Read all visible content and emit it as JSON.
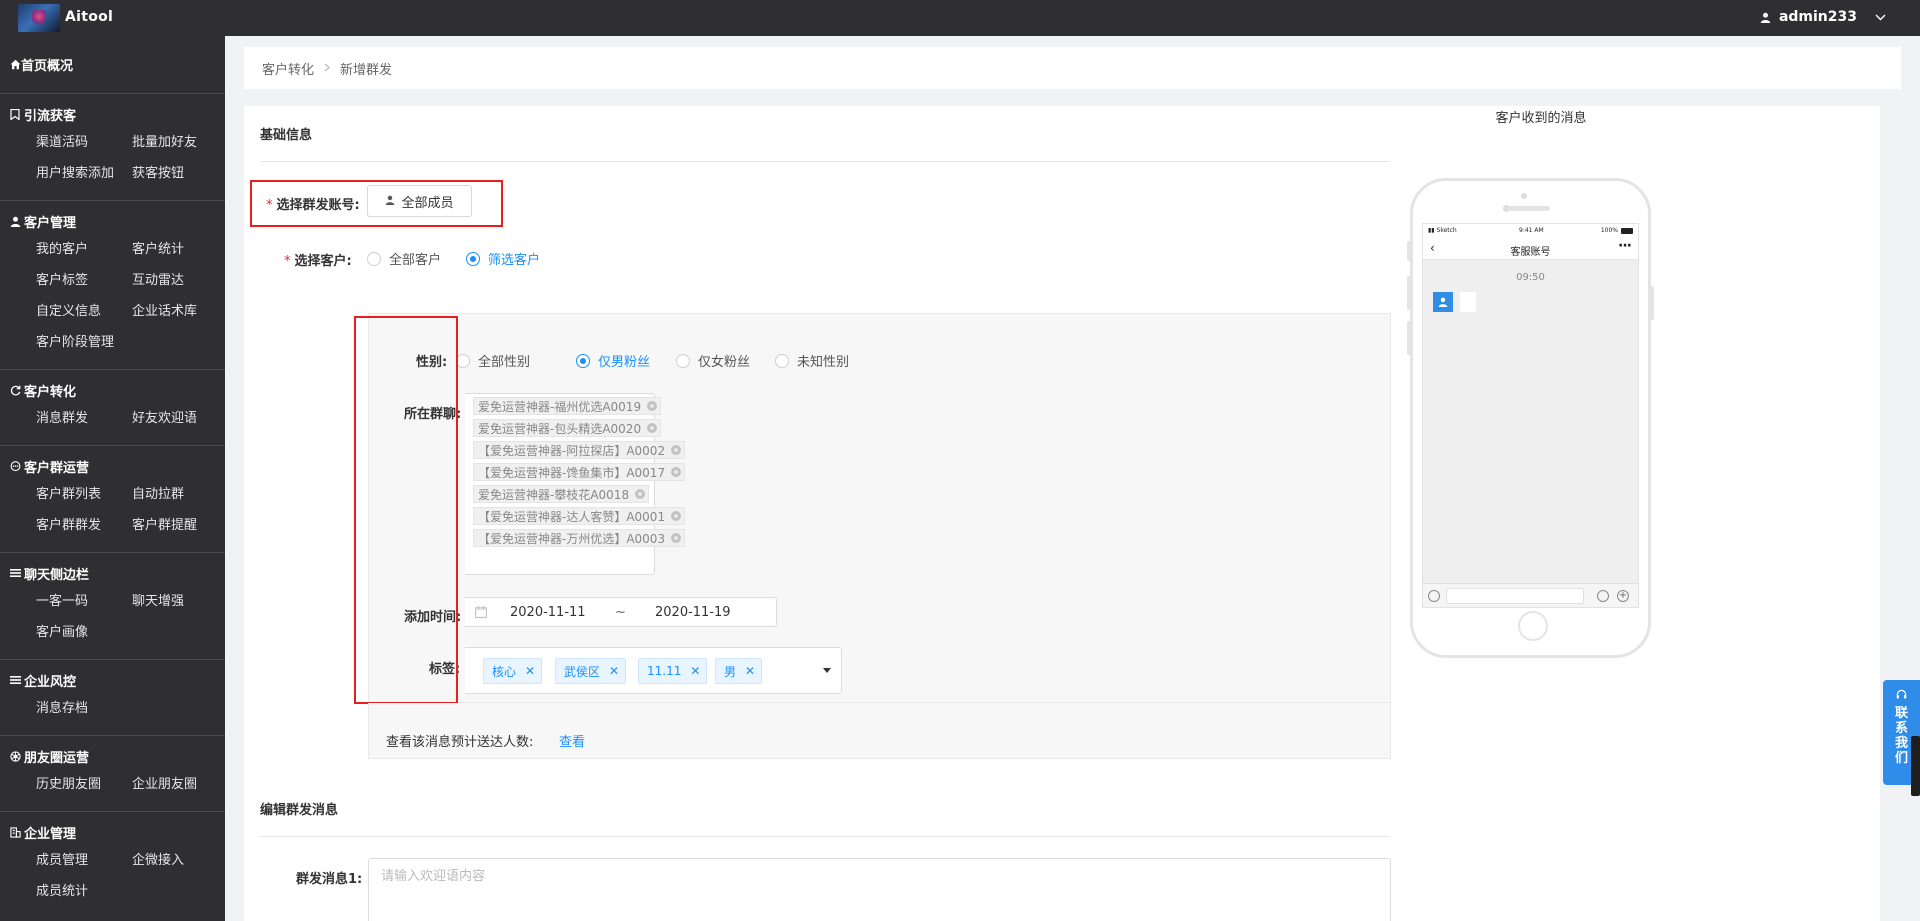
{
  "app": {
    "title": "Aitool",
    "user": "admin233"
  },
  "sidebar": {
    "home": "首页概况",
    "groups": [
      {
        "title": "引流获客",
        "icon": "bookmark-icon",
        "items": [
          "渠道活码",
          "批量加好友",
          "用户搜索添加",
          "获客按钮"
        ]
      },
      {
        "title": "客户管理",
        "icon": "user-icon",
        "items": [
          "我的客户",
          "客户统计",
          "客户标签",
          "互动雷达",
          "自定义信息",
          "企业话术库",
          "客户阶段管理"
        ]
      },
      {
        "title": "客户转化",
        "icon": "refresh-icon",
        "items": [
          "消息群发",
          "好友欢迎语"
        ]
      },
      {
        "title": "客户群运营",
        "icon": "chat-icon",
        "items": [
          "客户群列表",
          "自动拉群",
          "客户群群发",
          "客户群提醒"
        ]
      },
      {
        "title": "聊天侧边栏",
        "icon": "menu-icon",
        "items": [
          "一客一码",
          "聊天增强",
          "客户画像"
        ]
      },
      {
        "title": "企业风控",
        "icon": "menu-icon",
        "items": [
          "消息存档"
        ]
      },
      {
        "title": "朋友圈运营",
        "icon": "aperture-icon",
        "items": [
          "历史朋友圈",
          "企业朋友圈"
        ]
      },
      {
        "title": "企业管理",
        "icon": "building-icon",
        "items": [
          "成员管理",
          "企微接入",
          "成员统计"
        ]
      }
    ]
  },
  "breadcrumb": {
    "parent": "客户转化",
    "current": "新增群发"
  },
  "form": {
    "section_basic": "基础信息",
    "account_label": "选择群发账号:",
    "account_button": "全部成员",
    "customer_label": "选择客户:",
    "customer_options": [
      "全部客户",
      "筛选客户"
    ],
    "customer_selected": 1,
    "gender_label": "性别:",
    "gender_options": [
      "全部性别",
      "仅男粉丝",
      "仅女粉丝",
      "未知性别"
    ],
    "gender_selected": 1,
    "groups_label": "所在群聊:",
    "groups": [
      "爱免运营神器-福州优选A0019",
      "爱免运营神器-包头精选A0020",
      "【爱免运营神器-阿拉探店】A0002",
      "【爱免运营神器-馋鱼集市】A0017",
      "爱免运营神器-攀枝花A0018",
      "【爱免运营神器-达人客赞】A0001",
      "【爱免运营神器-万州优选】A0003"
    ],
    "time_label": "添加时间:",
    "date_start": "2020-11-11",
    "date_sep": "~",
    "date_end": "2020-11-19",
    "tags_label": "标签:",
    "tags": [
      "核心",
      "武侯区",
      "11.11",
      "男"
    ],
    "preview_text": "查看该消息预计送达人数:",
    "preview_link": "查看",
    "section_message": "编辑群发消息",
    "message_label": "群发消息1:",
    "message_placeholder": "请输入欢迎语内容"
  },
  "phone": {
    "caption": "客户收到的消息",
    "carrier": "Sketch",
    "clock": "9:41 AM",
    "battery": "100%",
    "chat_title": "客服账号",
    "chat_time": "09:50"
  },
  "contact": {
    "label": [
      "联",
      "系",
      "我",
      "们"
    ]
  },
  "colors": {
    "accent": "#1890ff",
    "sidebar_bg": "#2f2f33",
    "highlight_box": "#e81f1f"
  }
}
